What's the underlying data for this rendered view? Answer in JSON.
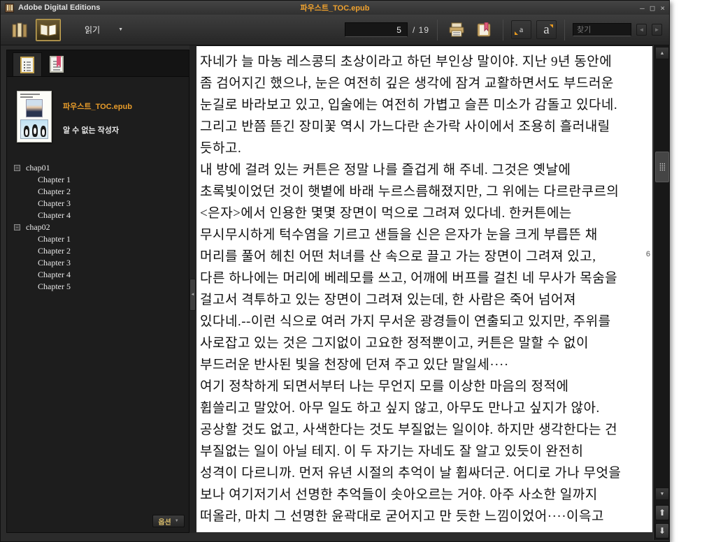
{
  "titlebar": {
    "app_title": "Adobe Digital Editions",
    "doc_title": "파우스트_TOC.epub",
    "minimize": "–",
    "maximize": "□",
    "close": "×"
  },
  "toolbar": {
    "view_menu_label": "읽기",
    "dropdown_caret": "▼",
    "page_current": "5",
    "page_total_label": "/ 19",
    "font_smaller_label": "a",
    "font_larger_label": "a",
    "search_placeholder": "찾기",
    "search_prev_glyph": "◄",
    "search_next_glyph": "►"
  },
  "sidebar": {
    "book_title": "파우스트_TOC.epub",
    "book_author": "알 수 없는 작성자",
    "collapse_glyph": "−",
    "toc": {
      "group1": {
        "label": "chap01",
        "children": [
          "Chapter 1",
          "Chapter 2",
          "Chapter 3",
          "Chapter 4"
        ]
      },
      "group2": {
        "label": "chap02",
        "children": [
          "Chapter 1",
          "Chapter 2",
          "Chapter 3",
          "Chapter 4",
          "Chapter 5"
        ]
      }
    },
    "options_button_label": "옵션",
    "options_caret": "▼"
  },
  "reader": {
    "page_number_label": "6",
    "lines": [
      "자네가 늘 마농 레스콩듸 초상이라고 하던 부인상 말이야. 지난 9년 동안에",
      "좀 검어지긴 했으나, 눈은 여전히 깊은 생각에 잠겨 교활하면서도 부드러운",
      "눈길로 바라보고 있고, 입술에는 여전히 가볍고 슬픈 미소가 감돌고 있다네.",
      "그리고 반쯤 뜯긴 장미꽃 역시 가느다란 손가락 사이에서 조용히 흘러내릴",
      "듯하고.",
      "내 방에 걸려 있는 커튼은 정말 나를 즐겁게 해 주네. 그것은 옛날에",
      "초록빛이었던 것이 햇볕에 바래 누르스름해졌지만, 그 위에는 다르란쿠르의",
      "<은자>에서 인용한 몇몇 장면이 먹으로 그려져 있다네. 한커튼에는",
      "무시무시하게 턱수염을 기르고 샌들을 신은 은자가 눈을 크게 부릅뜬 채",
      "머리를 풀어 헤친 어떤 처녀를 산 속으로 끌고 가는 장면이 그려져 있고,",
      "다른 하나에는 머리에 베레모를 쓰고, 어깨에 버프를 걸친 네 무사가 목숨을",
      "걸고서 격투하고 있는 장면이 그려져 있는데, 한 사람은 죽어 넘어져",
      "있다네.--이런 식으로 여러 가지 무서운 광경들이 연출되고 있지만, 주위를",
      "사로잡고 있는 것은 그지없이 고요한 정적뿐이고, 커튼은 말할 수 없이",
      "부드러운 반사된 빛을 천장에 던져 주고 있단 말일세····",
      "여기 정착하게 되면서부터 나는 무언지 모를 이상한 마음의 정적에",
      "휩쓸리고 말았어. 아무 일도 하고 싶지 않고, 아무도 만나고 싶지가 않아.",
      "공상할 것도 없고, 사색한다는 것도 부질없는 일이야. 하지만 생각한다는 건",
      "부질없는 일이 아닐 테지. 이 두 자기는 자네도 잘 알고 있듯이 완전히",
      "성격이 다르니까. 먼저 유년 시절의 추억이 날 휩싸더군. 어디로 가나 무엇을",
      "보나 여기저기서 선명한 추억들이 솟아오르는 거야. 아주 사소한 일까지",
      "떠올라, 마치 그 선명한 윤곽대로 굳어지고 만 듯한 느낌이었어····이윽고"
    ]
  },
  "scrollbar": {
    "up_glyph": "▲",
    "down_glyph": "▼",
    "page_up_glyph": "⬆",
    "page_down_glyph": "⬇"
  },
  "colors": {
    "accent_orange": "#f0a22e",
    "gold_border": "#c9a753",
    "bookmark_red": "#d94f72",
    "reader_bg": "#ffffff"
  }
}
